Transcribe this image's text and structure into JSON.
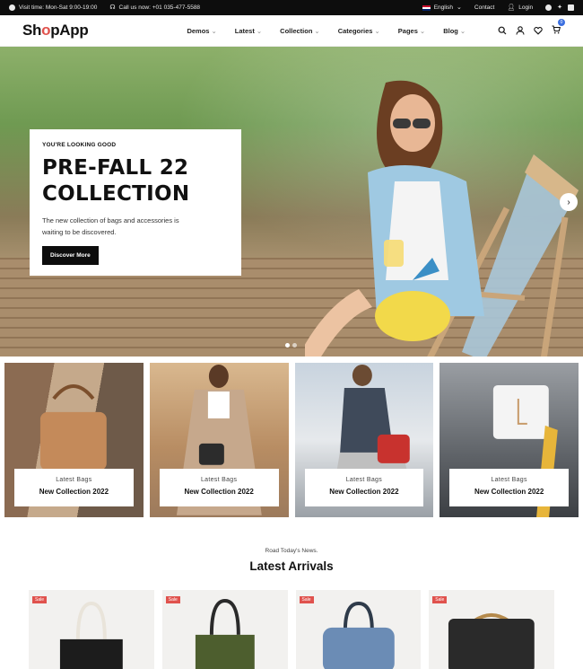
{
  "topbar": {
    "hours": "Visit time: Mon-Sat 9:00-19:00",
    "phone": "Call us now: +01 035-477-5588",
    "language": "English",
    "contact": "Contact",
    "login": "Login"
  },
  "header": {
    "logo_prefix": "Sh",
    "logo_o": "o",
    "logo_suffix": "pApp",
    "nav": [
      "Demos",
      "Latest",
      "Collection",
      "Categories",
      "Pages",
      "Blog"
    ],
    "cart_count": "0"
  },
  "hero": {
    "kicker": "YOU'RE LOOKING GOOD",
    "title_line1": "PRE-FALL 22",
    "title_line2": "COLLECTION",
    "description": "The new collection of bags and accessories is waiting to be discovered.",
    "cta": "Discover More"
  },
  "tiles": [
    {
      "subtitle": "Latest Bags",
      "title": "New Collection 2022"
    },
    {
      "subtitle": "Latest Bags",
      "title": "New Collection 2022"
    },
    {
      "subtitle": "Latest Bags",
      "title": "New Collection 2022"
    },
    {
      "subtitle": "Latest Bags",
      "title": "New Collection 2022"
    }
  ],
  "arrivals": {
    "subtitle": "Road Today's News.",
    "title": "Latest Arrivals",
    "sale_label": "Sale"
  },
  "colors": {
    "accent": "#e0524d",
    "badge": "#3b6fe0",
    "dark": "#0d0d0d"
  }
}
